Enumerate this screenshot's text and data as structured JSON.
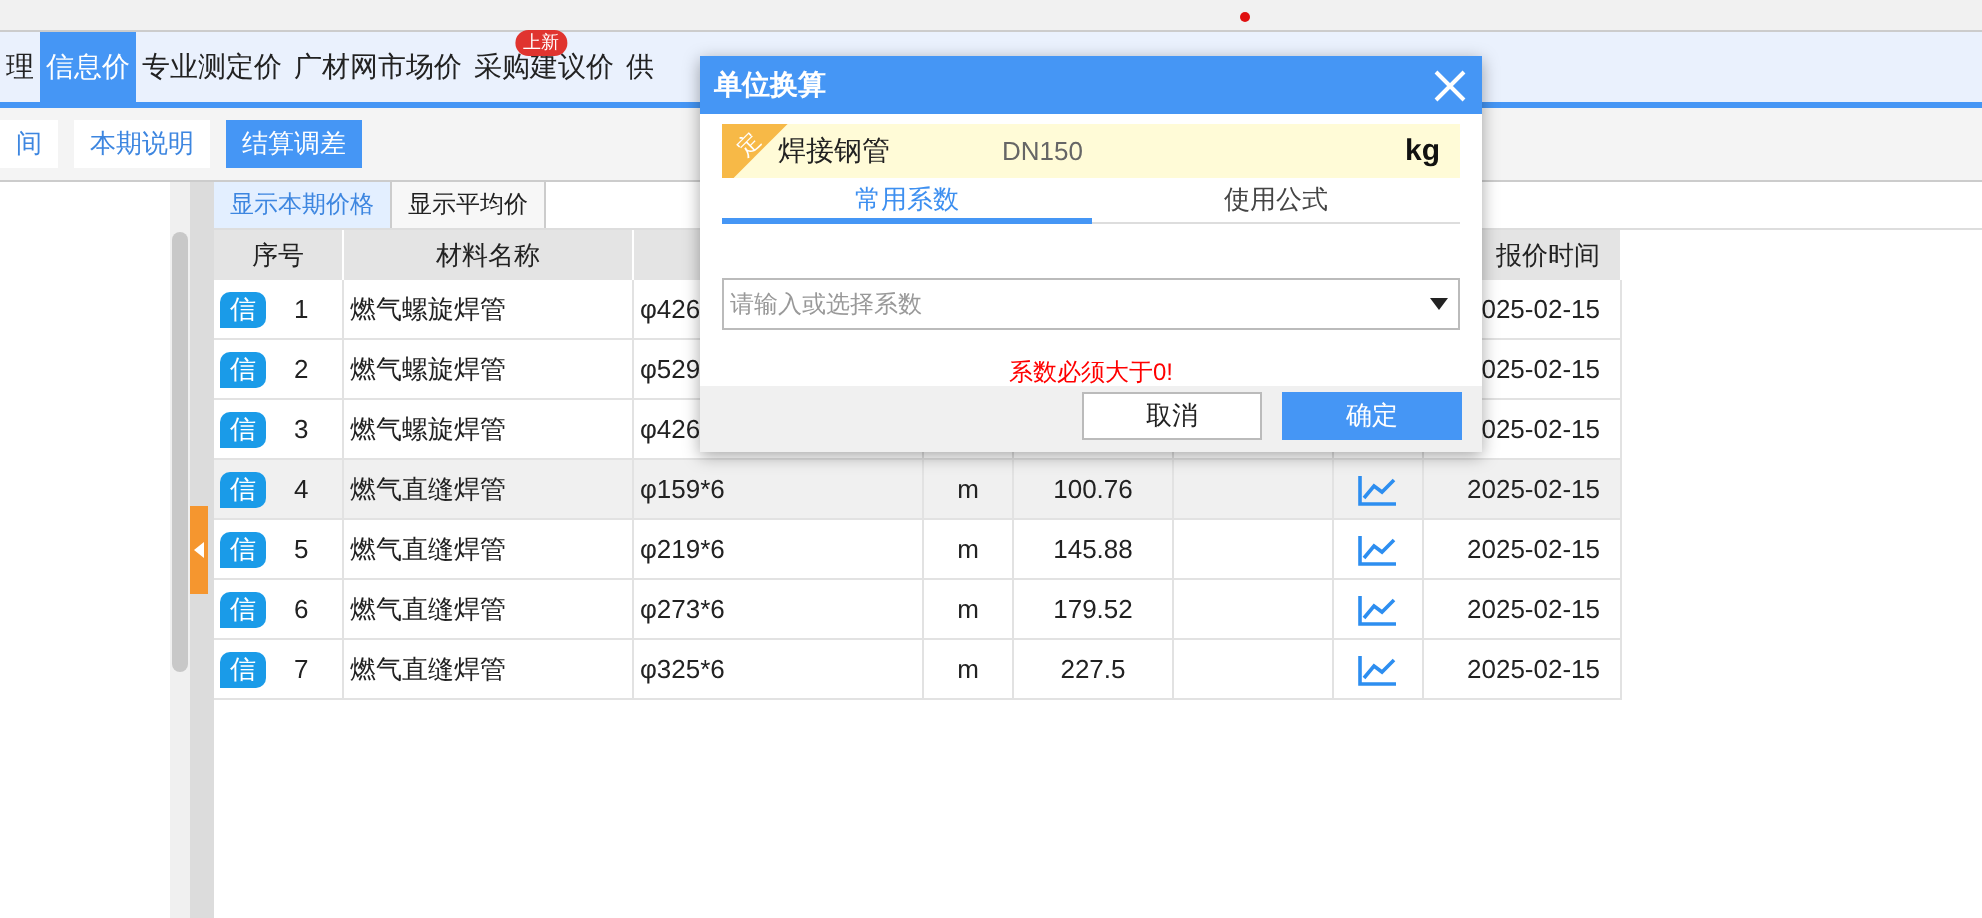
{
  "nav_tabs": [
    {
      "label": "理",
      "selected": false
    },
    {
      "label": "信息价",
      "selected": true
    },
    {
      "label": "专业测定价",
      "selected": false
    },
    {
      "label": "广材网市场价",
      "selected": false
    },
    {
      "label": "采购建议价",
      "selected": false,
      "badge": "上新"
    },
    {
      "label": "供",
      "selected": false
    }
  ],
  "toolbar": [
    {
      "label": "间",
      "selected": false
    },
    {
      "label": "本期说明",
      "selected": false
    },
    {
      "label": "结算调差",
      "selected": true
    }
  ],
  "view_tabs": [
    {
      "label": "显示本期价格",
      "selected": true
    },
    {
      "label": "显示平均价",
      "selected": false
    }
  ],
  "header": {
    "seq": "序号",
    "name": "材料名称",
    "date": "报价时间"
  },
  "rows": [
    {
      "tag": "信",
      "seq": "1",
      "name": "燃气螺旋焊管",
      "spec": "φ426",
      "date": "025-02-15",
      "selected": false
    },
    {
      "tag": "信",
      "seq": "2",
      "name": "燃气螺旋焊管",
      "spec": "φ529",
      "date": "025-02-15",
      "selected": false
    },
    {
      "tag": "信",
      "seq": "3",
      "name": "燃气螺旋焊管",
      "spec": "φ426",
      "date": "025-02-15",
      "selected": false
    },
    {
      "tag": "信",
      "seq": "4",
      "name": "燃气直缝焊管",
      "spec": "φ159*6",
      "unit": "m",
      "price": "100.76",
      "date": "2025-02-15",
      "trend": true,
      "selected": true
    },
    {
      "tag": "信",
      "seq": "5",
      "name": "燃气直缝焊管",
      "spec": "φ219*6",
      "unit": "m",
      "price": "145.88",
      "date": "2025-02-15",
      "trend": true,
      "selected": false
    },
    {
      "tag": "信",
      "seq": "6",
      "name": "燃气直缝焊管",
      "spec": "φ273*6",
      "unit": "m",
      "price": "179.52",
      "date": "2025-02-15",
      "trend": true,
      "selected": false
    },
    {
      "tag": "信",
      "seq": "7",
      "name": "燃气直缝焊管",
      "spec": "φ325*6",
      "unit": "m",
      "price": "227.5",
      "date": "2025-02-15",
      "trend": true,
      "selected": false
    }
  ],
  "dialog": {
    "title": "单位换算",
    "product": {
      "ribbon": "定",
      "name": "焊接钢管",
      "spec": "DN150",
      "unit": "kg"
    },
    "tabs": [
      {
        "label": "常用系数",
        "selected": true
      },
      {
        "label": "使用公式",
        "selected": false
      }
    ],
    "field": {
      "placeholder": "请输入或选择系数"
    },
    "error": "系数必须大于0!",
    "buttons": [
      {
        "label": "取消",
        "kind": "secondary"
      },
      {
        "label": "确定",
        "kind": "primary"
      }
    ]
  }
}
